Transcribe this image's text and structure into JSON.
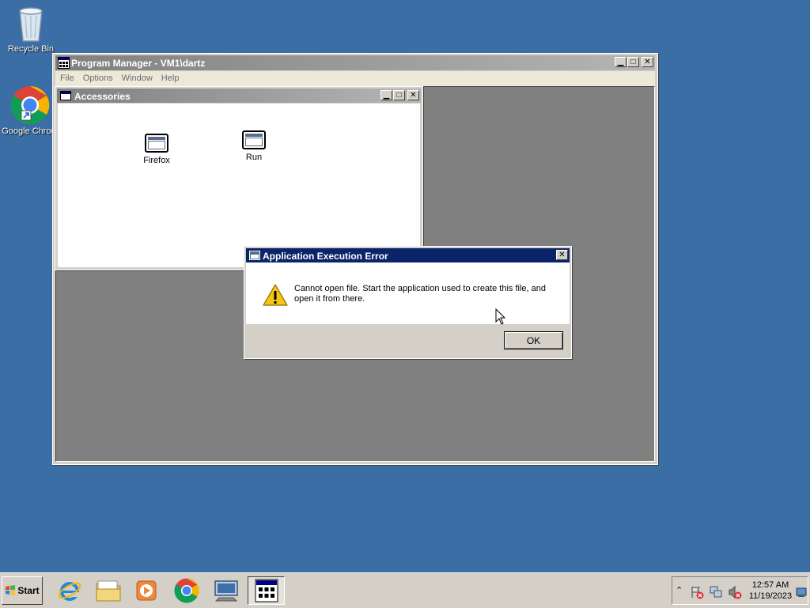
{
  "desktop": {
    "icons": [
      {
        "label": "Recycle Bin"
      },
      {
        "label": "Google Chrom"
      }
    ]
  },
  "program_manager": {
    "title": "Program Manager - VM1\\dartz",
    "menu": [
      "File",
      "Options",
      "Window",
      "Help"
    ]
  },
  "accessories": {
    "title": "Accessories",
    "programs": [
      {
        "label": "Firefox"
      },
      {
        "label": "Run"
      }
    ]
  },
  "dialog": {
    "title": "Application Execution Error",
    "message": "Cannot open file. Start the application used to create this file, and open it from there.",
    "ok_label": "OK",
    "title_color": "#0a246a"
  },
  "taskbar": {
    "start_label": "Start",
    "pinned": [
      "internet-explorer-icon",
      "file-explorer-icon",
      "media-player-icon",
      "chrome-icon",
      "remote-desktop-icon",
      "program-manager-icon"
    ],
    "clock_time": "12:57 AM",
    "clock_date": "11/19/2023"
  }
}
